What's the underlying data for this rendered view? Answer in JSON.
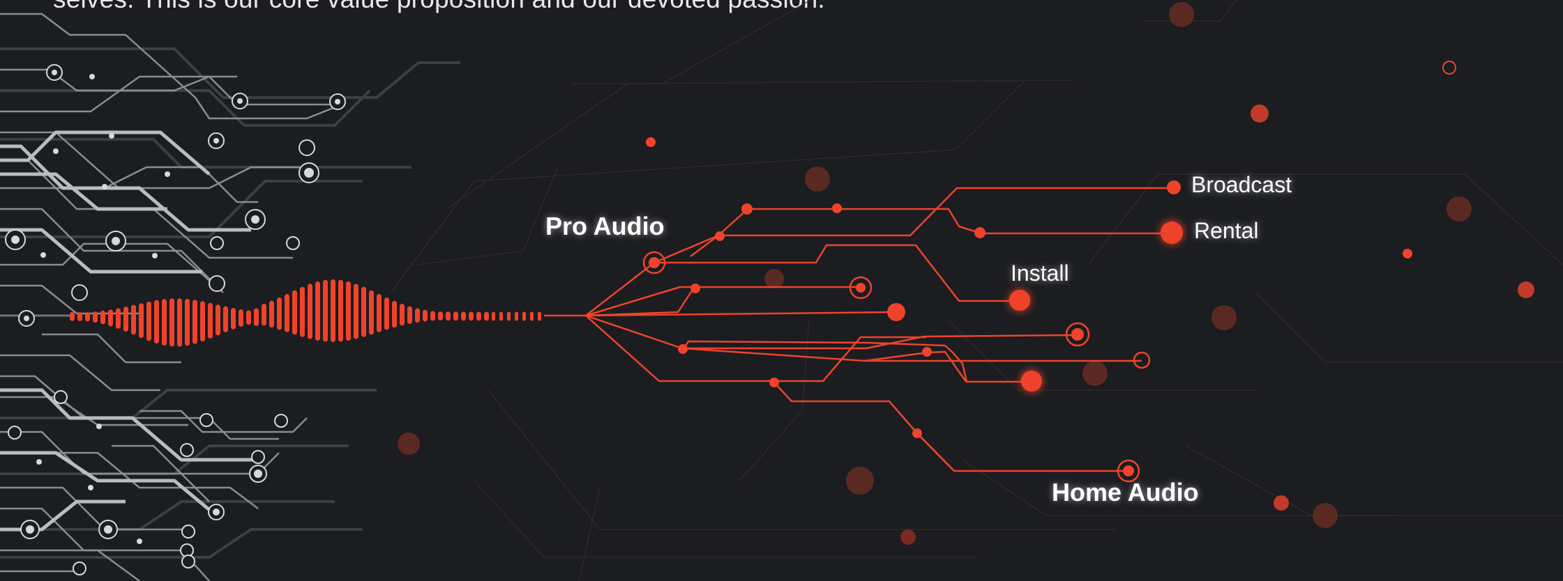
{
  "intro_text": "selves. This is our core value proposition and our devoted passion.",
  "segments": {
    "pro_audio": "Pro Audio",
    "home_audio": "Home Audio",
    "broadcast": "Broadcast",
    "rental": "Rental",
    "install": "Install"
  },
  "colors": {
    "background": "#1b1d20",
    "accent": "#f0432c",
    "circuit": "#c8c8c8",
    "text": "#ffffff"
  }
}
